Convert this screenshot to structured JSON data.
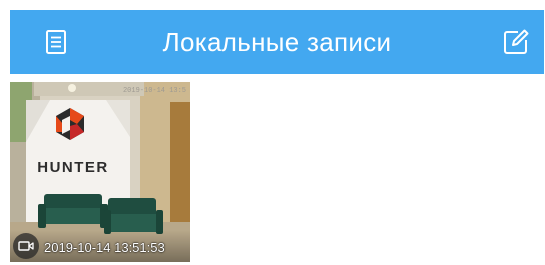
{
  "header": {
    "title": "Локальные записи",
    "left_icon": "list-icon",
    "right_icon": "edit-icon",
    "background": "#43a8f0"
  },
  "recordings": [
    {
      "timestamp": "2019-10-14 13:51:53",
      "type_icon": "video-camera-icon",
      "banner_text": "HUNTER",
      "osd_text": "2019-10-14 13:5"
    }
  ]
}
